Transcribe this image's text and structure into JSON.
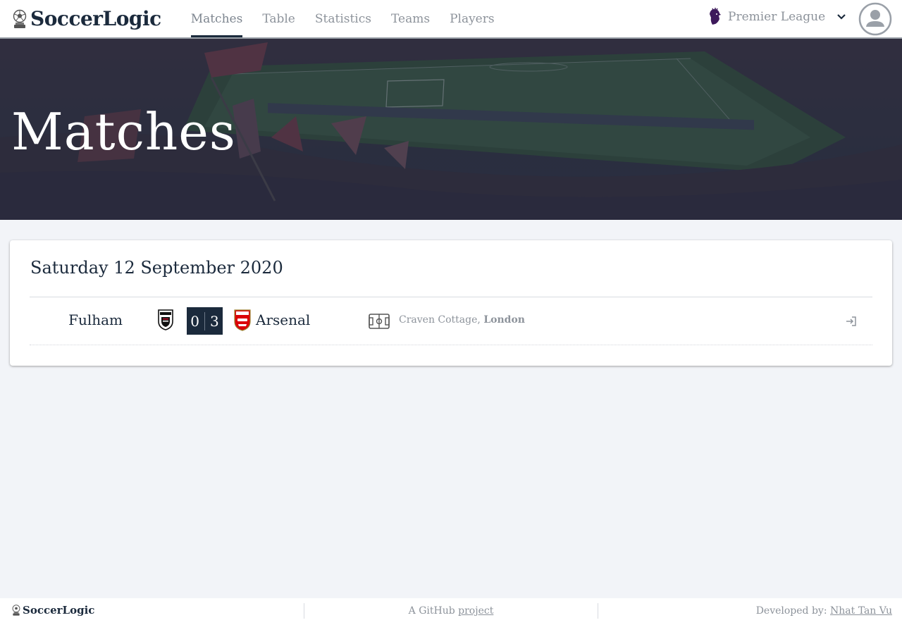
{
  "brand": {
    "name": "SoccerLogic",
    "icon": "trophy-ball-icon"
  },
  "nav": {
    "items": [
      {
        "label": "Matches",
        "active": true
      },
      {
        "label": "Table",
        "active": false
      },
      {
        "label": "Statistics",
        "active": false
      },
      {
        "label": "Teams",
        "active": false
      },
      {
        "label": "Players",
        "active": false
      }
    ]
  },
  "league": {
    "name": "Premier League",
    "icon": "premier-league-lion-icon"
  },
  "hero": {
    "title": "Matches"
  },
  "matchday": {
    "date": "Saturday 12 September 2020",
    "matches": [
      {
        "home": "Fulham",
        "away": "Arsenal",
        "home_score": "0",
        "away_score": "3",
        "venue": "Craven Cottage",
        "city": "London",
        "separator": ","
      }
    ]
  },
  "footer": {
    "brand": "SoccerLogic",
    "center_prefix": "A GitHub ",
    "center_link": "project",
    "right_prefix": "Developed by: ",
    "right_link": "Nhat Tan Vu"
  },
  "colors": {
    "navy": "#1b2a3c",
    "muted": "#8d939b",
    "background": "#f2f4f8",
    "arsenal_red": "#db0007"
  }
}
